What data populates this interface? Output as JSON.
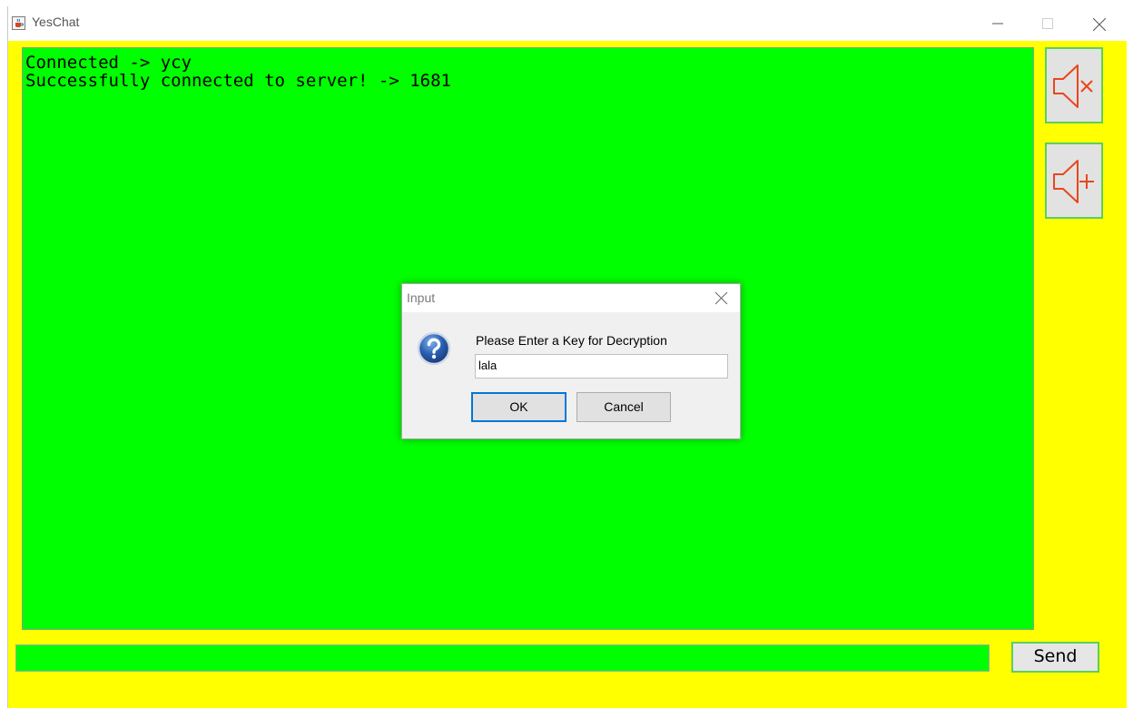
{
  "window": {
    "title": "YesChat",
    "app_icon": "java-coffee-icon"
  },
  "chat": {
    "lines": [
      "Connected -> ycy",
      "Successfully connected to server! -> 1681"
    ]
  },
  "side_buttons": {
    "mute_icon": "speaker-mute-icon",
    "volume_up_icon": "speaker-plus-icon"
  },
  "composer": {
    "message_value": "",
    "send_label": "Send"
  },
  "dialog": {
    "title": "Input",
    "prompt": "Please Enter a Key for Decryption",
    "key_value": "lala",
    "ok_label": "OK",
    "cancel_label": "Cancel",
    "icon": "question-icon"
  },
  "colors": {
    "background": "#ffff00",
    "chat_area": "#00ff00",
    "button_border": "#5ccf5c",
    "speaker_icon": "#e8471b",
    "default_button_border": "#0078d7"
  }
}
